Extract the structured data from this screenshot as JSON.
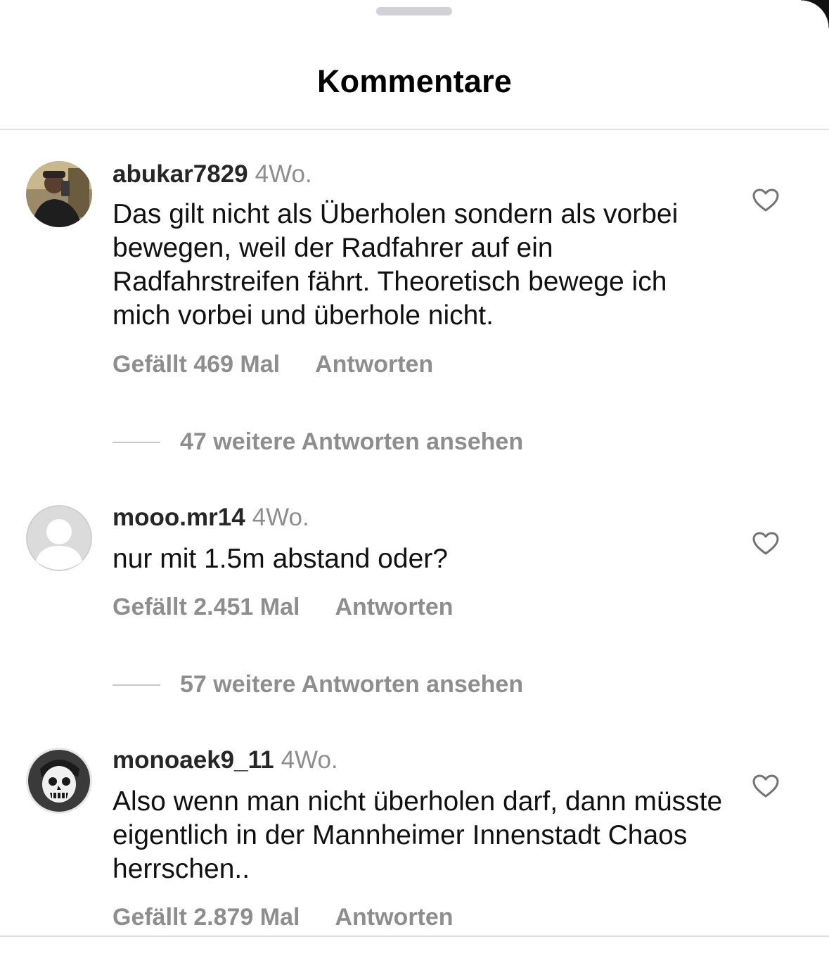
{
  "header": {
    "title": "Kommentare"
  },
  "comments": [
    {
      "username": "abukar7829",
      "time": "4Wo.",
      "text": "Das gilt nicht als Überholen sondern als vorbei bewegen, weil der Radfahrer auf ein Radfahrstreifen fährt. Theoretisch bewege ich mich vorbei und überhole nicht.",
      "likes": "Gefällt 469 Mal",
      "reply": "Antworten",
      "more_replies": "47 weitere Antworten ansehen"
    },
    {
      "username": "mooo.mr14",
      "time": "4Wo.",
      "text": "nur mit 1.5m abstand oder?",
      "likes": "Gefällt 2.451 Mal",
      "reply": "Antworten",
      "more_replies": "57 weitere Antworten ansehen"
    },
    {
      "username": "monoaek9_11",
      "time": "4Wo.",
      "text": "Also wenn man nicht überholen darf, dann müsste eigentlich in der Mannheimer Innenstadt Chaos herrschen..",
      "likes": "Gefällt 2.879 Mal",
      "reply": "Antworten"
    }
  ],
  "icons": {
    "like": "heart-outline-icon",
    "default_avatar": "person-silhouette-icon"
  },
  "colors": {
    "secondary_text": "#8e8e8e",
    "divider": "#e2e2e2",
    "grabber": "#d1d1d6"
  }
}
